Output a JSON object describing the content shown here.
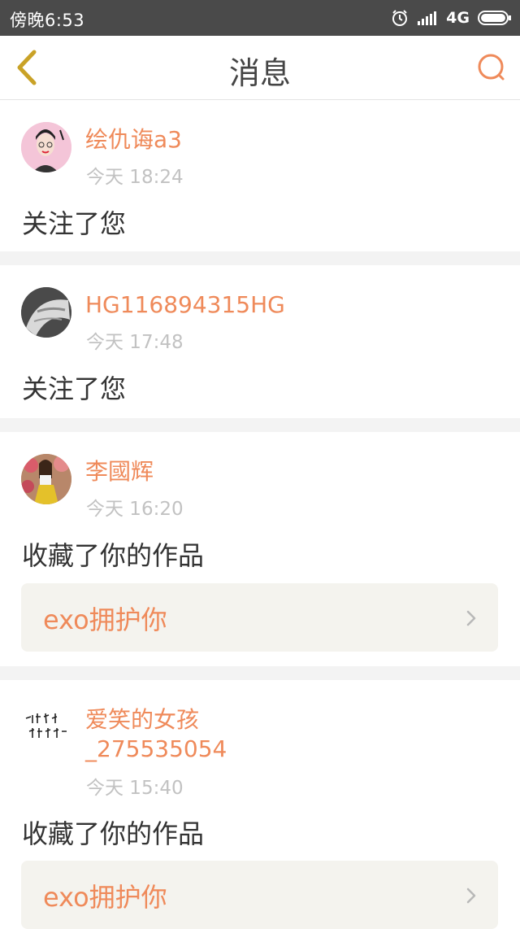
{
  "status_bar": {
    "time": "傍晚6:53",
    "network": "4G",
    "icons": [
      "alarm-icon",
      "signal-icon",
      "battery-icon"
    ]
  },
  "header": {
    "title": "消息",
    "back_icon": "chevron-left-icon",
    "search_icon": "search-icon"
  },
  "colors": {
    "accent": "#ef8a5a",
    "back_icon": "#c9a227",
    "separator": "#f3f3f3",
    "work_card_bg": "#f4f3ee"
  },
  "notifications": [
    {
      "user": "绘仇诲a3",
      "time": "今天 18:24",
      "action": "关注了您"
    },
    {
      "user": "HG116894315HG",
      "time": "今天 17:48",
      "action": "关注了您"
    },
    {
      "user": "李國辉",
      "time": "今天 16:20",
      "action": "收藏了你的作品",
      "work_title": "exo拥护你"
    },
    {
      "user_line1": "爱笑的女孩",
      "user_line2": "_275535054",
      "time": "今天 15:40",
      "action": "收藏了你的作品",
      "work_title": "exo拥护你"
    }
  ]
}
